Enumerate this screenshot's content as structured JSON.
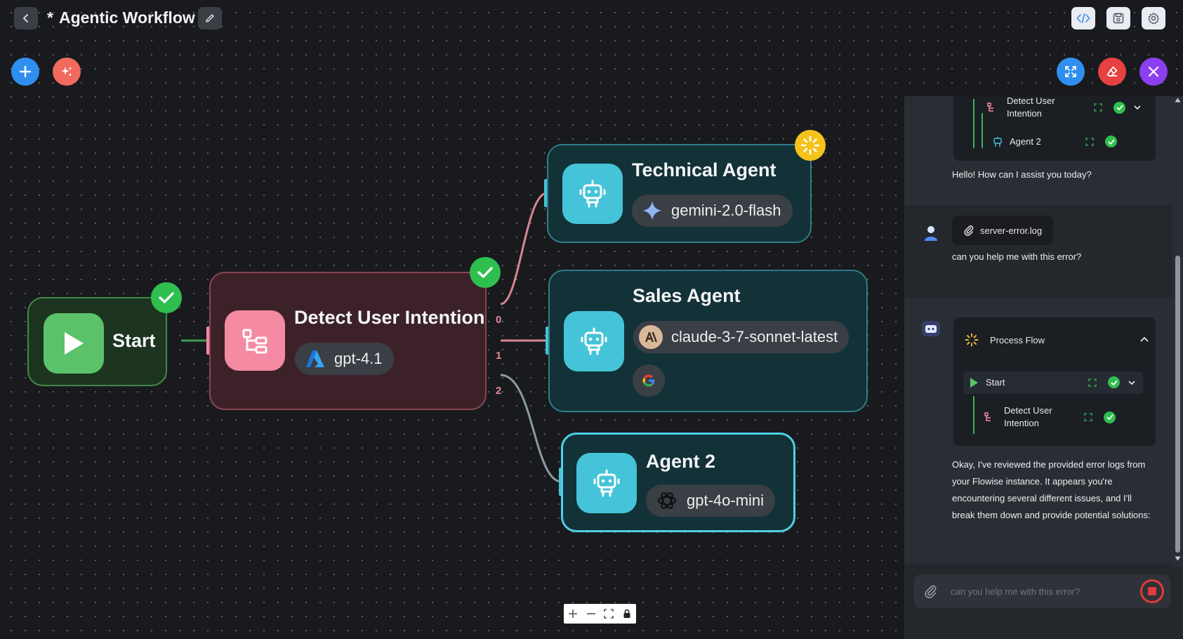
{
  "header": {
    "title_marker": "*",
    "title": "Agentic Workflow"
  },
  "nodes": {
    "start": {
      "title": "Start"
    },
    "detect": {
      "title": "Detect User Intention",
      "model": "gpt-4.1",
      "ports": [
        "0",
        "1",
        "2"
      ]
    },
    "technical": {
      "title": "Technical Agent",
      "model": "gemini-2.0-flash"
    },
    "sales": {
      "title": "Sales Agent",
      "model": "claude-3-7-sonnet-latest"
    },
    "agent2": {
      "title": "Agent 2",
      "model": "gpt-4o-mini"
    }
  },
  "chat": {
    "top_flow": {
      "item1": "Detect User Intention",
      "item2": "Agent 2"
    },
    "greeting": "Hello! How can I assist you today?",
    "attachment": "server-error.log",
    "user_message": "can you help me with this error?",
    "process_flow": {
      "label": "Process Flow",
      "start": "Start",
      "detect": "Detect User Intention"
    },
    "response": "Okay, I've reviewed the provided error logs from your Flowise instance. It appears you're encountering several different issues, and I'll break them down and provide potential solutions:",
    "input_placeholder": "can you help me with this error?"
  },
  "colors": {
    "canvas": "#191a1d",
    "start_node": "#5bc26a",
    "detect_node": "#f58aa3",
    "agent_node": "#45c3d8",
    "add_button": "#2f8ff0",
    "magic_button": "#f06b5e",
    "eraser_button": "#e84141",
    "close_button": "#8b3ff0",
    "check": "#2fbf4f",
    "spinner": "#f4c21b"
  }
}
